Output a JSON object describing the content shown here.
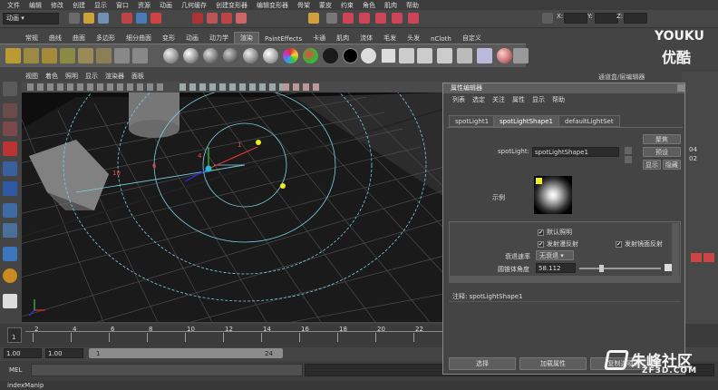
{
  "menubar": [
    "文件",
    "编辑",
    "修改",
    "创建",
    "显示",
    "窗口",
    "资源",
    "动画",
    "几何缓存",
    "创建变形器",
    "编辑变形器",
    "骨架",
    "蒙皮",
    "约束",
    "角色",
    "肌肉",
    "帮助"
  ],
  "mode_selector": "动画",
  "coords": {
    "x": "X:",
    "y": "Y:",
    "z": "Z:"
  },
  "shelf_tabs": [
    "常规",
    "曲线",
    "曲面",
    "多边形",
    "细分曲面",
    "变形",
    "动画",
    "动力学",
    "渲染",
    "PaintEffects",
    "卡通",
    "肌肉",
    "流体",
    "毛发",
    "头发",
    "nCloth",
    "自定义"
  ],
  "shelf_active": "渲染",
  "panel_menu": [
    "视图",
    "着色",
    "照明",
    "显示",
    "渲染器",
    "面板"
  ],
  "viewport_labels": {
    "n10": "10",
    "n6": "6",
    "n4": "4",
    "n1": "1"
  },
  "timeline": {
    "ticks": [
      "2",
      "4",
      "6",
      "8",
      "10",
      "12",
      "14",
      "16",
      "18",
      "20",
      "22",
      "24"
    ],
    "current": "1"
  },
  "range": {
    "start": "1.00",
    "start2": "1.00",
    "inner_start": "1",
    "inner_end": "24"
  },
  "cmd": {
    "label": "MEL"
  },
  "helpline": "indexManip",
  "right_panel": {
    "tab": "通道盒/层编辑器",
    "vals": [
      "04",
      "02"
    ]
  },
  "ae": {
    "title": "属性编辑器",
    "menu": [
      "列表",
      "选定",
      "关注",
      "属性",
      "显示",
      "帮助"
    ],
    "tabs": [
      "spotLight1",
      "spotLightShape1",
      "defaultLightSet"
    ],
    "light_label": "spotLight:",
    "light_value": "spotLightShape1",
    "btn_focus": "聚焦",
    "btn_preset": "预设",
    "btn_show": "显示",
    "btn_hide": "隐藏",
    "sample_label": "示例",
    "default_light": "默认照明",
    "emit_diffuse": "发射漫反射",
    "emit_specular": "发射镜面反射",
    "decay_label": "衰退速率",
    "decay_value": "无衰退",
    "cone_label": "圆锥体角度",
    "cone_value": "58.112",
    "notes": "注释: spotLightShape1",
    "btn_select": "选择",
    "btn_load": "加载属性",
    "btn_copy": "复制选项卡"
  },
  "watermark": {
    "brand": "YOUKU",
    "brand_cn": "优酷",
    "site": "朱峰社区",
    "url": "ZF3D.COM"
  }
}
